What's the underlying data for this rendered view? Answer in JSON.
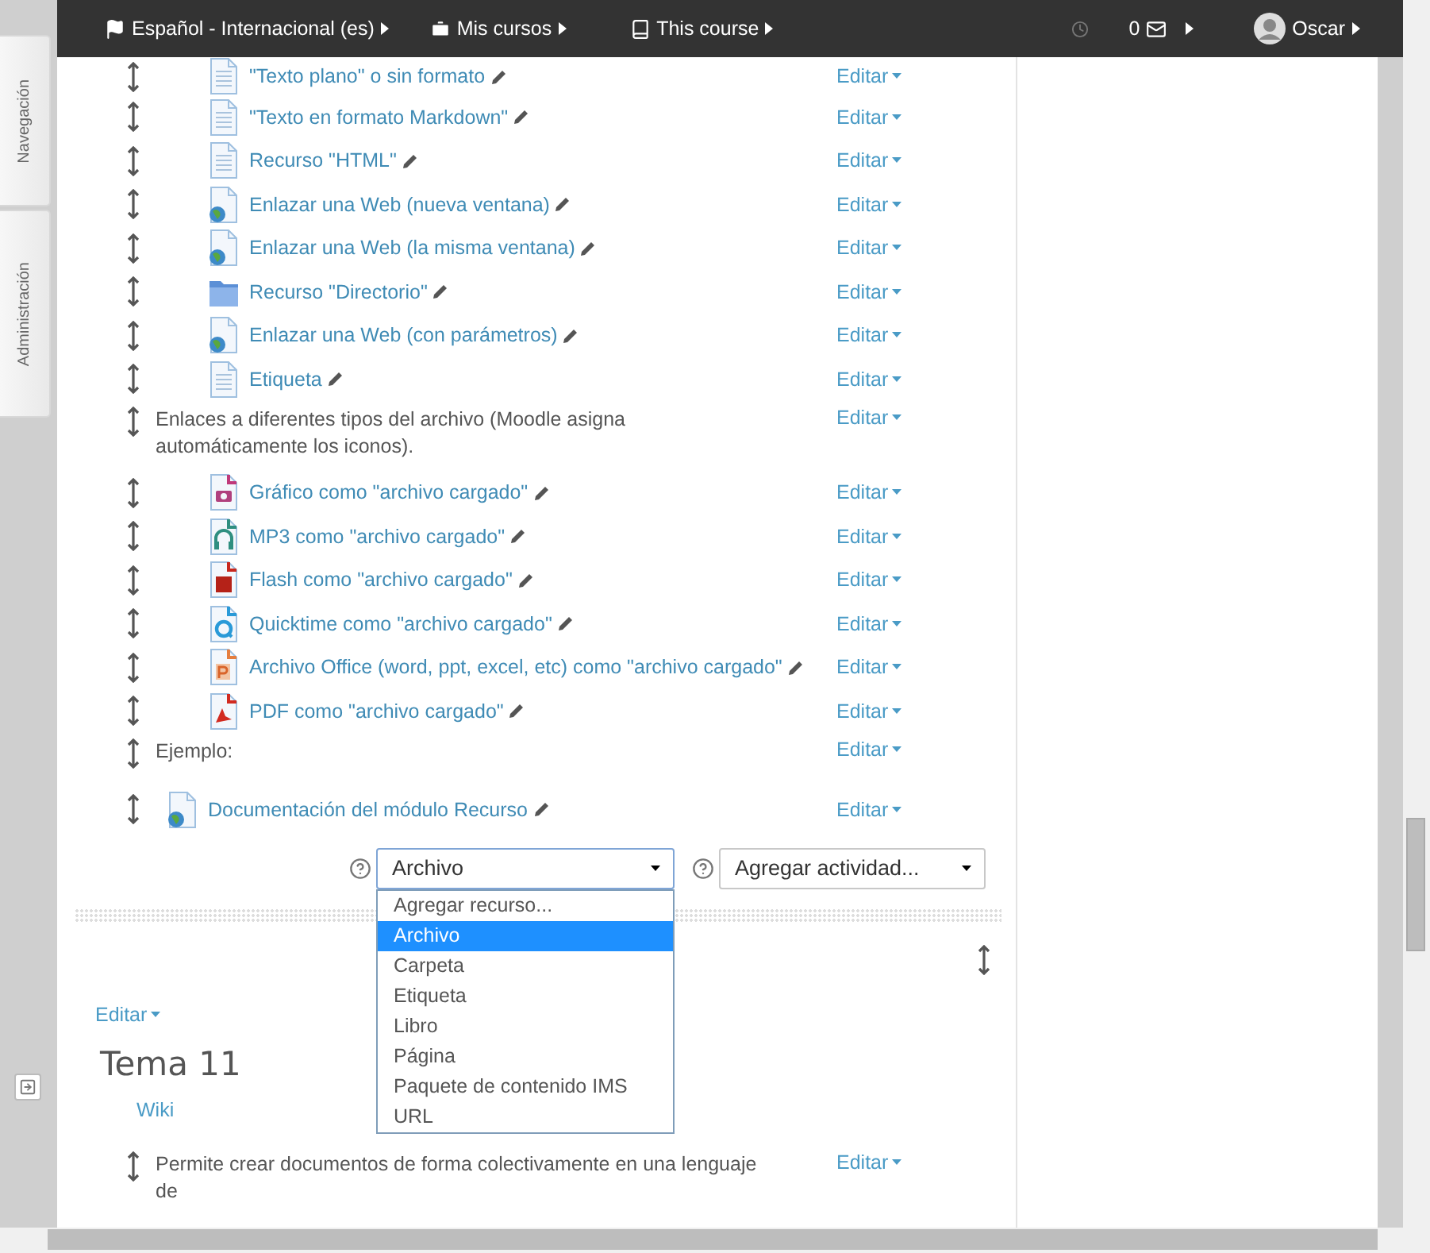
{
  "topbar": {
    "language": "Español - Internacional (es)",
    "my_courses": "Mis cursos",
    "this_course": "This course",
    "messages_count": "0",
    "user": "Oscar"
  },
  "side_tabs": [
    "Navegación",
    "Administración"
  ],
  "section": {
    "items": [
      {
        "kind": "page",
        "label": "\"Texto plano\" o sin formato",
        "indented": true,
        "edit": "Editar"
      },
      {
        "kind": "page",
        "label": "\"Texto en formato Markdown\"",
        "indented": true,
        "edit": "Editar"
      },
      {
        "kind": "page",
        "label": "Recurso \"HTML\"",
        "indented": true,
        "edit": "Editar"
      },
      {
        "kind": "url",
        "label": "Enlazar una Web (nueva ventana)",
        "indented": true,
        "edit": "Editar"
      },
      {
        "kind": "url",
        "label": "Enlazar una Web (la misma ventana)",
        "indented": true,
        "edit": "Editar"
      },
      {
        "kind": "folder",
        "label": "Recurso \"Directorio\"",
        "indented": true,
        "edit": "Editar"
      },
      {
        "kind": "url",
        "label": "Enlazar una Web (con parámetros)",
        "indented": true,
        "edit": "Editar"
      },
      {
        "kind": "page",
        "label": "Etiqueta",
        "indented": true,
        "edit": "Editar"
      },
      {
        "kind": "text",
        "label": "Enlaces a diferentes tipos del archivo (Moodle asigna automáticamente los iconos).",
        "edit": "Editar"
      },
      {
        "kind": "image",
        "label": "Gráfico como \"archivo cargado\"",
        "indented": true,
        "edit": "Editar"
      },
      {
        "kind": "audio",
        "label": "MP3 como \"archivo cargado\"",
        "indented": true,
        "edit": "Editar"
      },
      {
        "kind": "flash",
        "label": "Flash como \"archivo cargado\"",
        "indented": true,
        "edit": "Editar"
      },
      {
        "kind": "quicktime",
        "label": "Quicktime como \"archivo cargado\"",
        "indented": true,
        "edit": "Editar"
      },
      {
        "kind": "office",
        "label": "Archivo Office (word, ppt, excel, etc) como \"archivo cargado\"",
        "indented": true,
        "edit": "Editar"
      },
      {
        "kind": "pdf",
        "label": "PDF como \"archivo cargado\"",
        "indented": true,
        "edit": "Editar"
      },
      {
        "kind": "text",
        "label": "Ejemplo:",
        "edit": "Editar"
      },
      {
        "kind": "url",
        "label": "Documentación del módulo Recurso",
        "indented": false,
        "edit": "Editar"
      }
    ]
  },
  "add_resource": {
    "value": "Archivo",
    "expanded": true,
    "options": [
      {
        "label": "Agregar recurso...",
        "selected": false
      },
      {
        "label": "Archivo",
        "selected": true
      },
      {
        "label": "Carpeta",
        "selected": false
      },
      {
        "label": "Etiqueta",
        "selected": false
      },
      {
        "label": "Libro",
        "selected": false
      },
      {
        "label": "Página",
        "selected": false
      },
      {
        "label": "Paquete de contenido IMS",
        "selected": false
      },
      {
        "label": "URL",
        "selected": false
      }
    ]
  },
  "add_activity": {
    "value": "Agregar actividad..."
  },
  "next_section": {
    "edit": "Editar",
    "title": "Tema 11",
    "link": "Wiki",
    "items": [
      {
        "kind": "text",
        "label": "Permite crear documentos de forma colectivamente en una lenguaje de",
        "edit": "Editar"
      }
    ]
  }
}
